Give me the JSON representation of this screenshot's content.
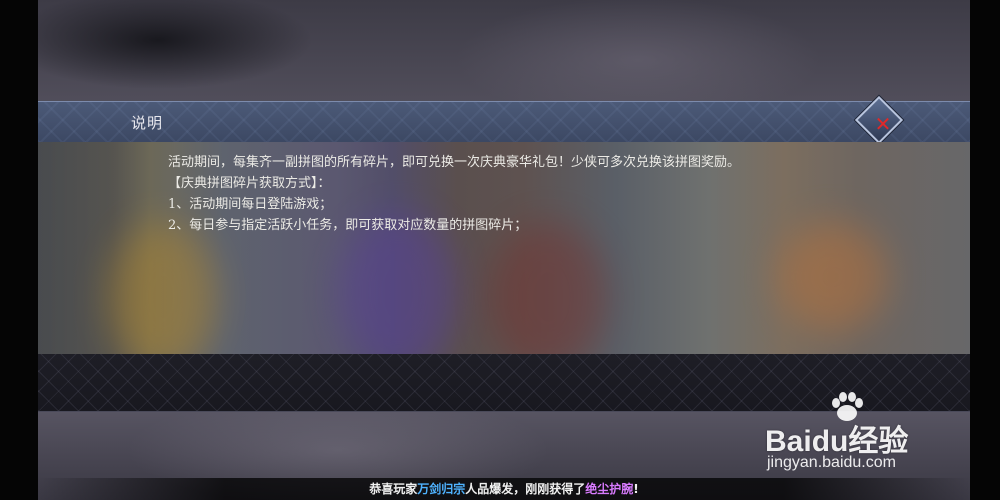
{
  "dialog": {
    "title": "说明",
    "paragraph1": "活动期间，每集齐一副拼图的所有碎片，即可兑换一次庆典豪华礼包！少侠可多次兑换该拼图奖励。",
    "section_heading": "【庆典拼图碎片获取方式】：",
    "items": [
      "1、活动期间每日登陆游戏；",
      "2、每日参与指定活跃小任务，即可获取对应数量的拼图碎片；"
    ],
    "close_icon": "close-icon",
    "colors": {
      "header": "#46536f",
      "close_x": "#e02828"
    }
  },
  "announcement": {
    "prefix": "恭喜玩家",
    "guild": "万剑归宗",
    "middle": "人品爆发，刚刚获得了",
    "item": "绝尘护腕",
    "suffix": "!",
    "colors": {
      "guild": "#4fb3ff",
      "item": "#d97bff"
    }
  },
  "watermark": {
    "logo_text": "Bai",
    "logo_du": "du",
    "logo_cn": "经验",
    "url": "jingyan.baidu.com"
  }
}
